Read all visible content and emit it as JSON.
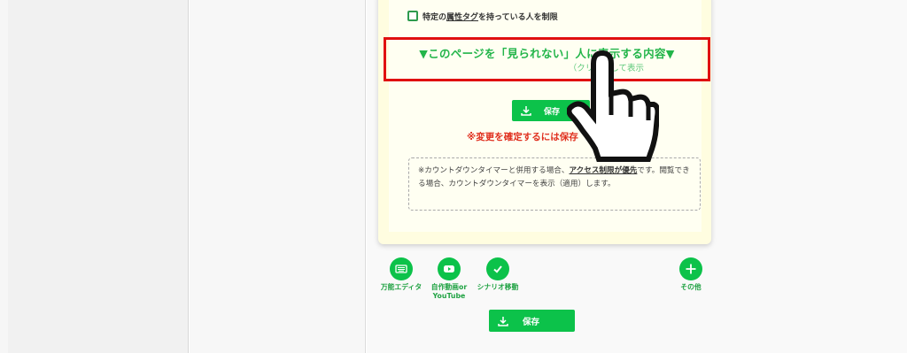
{
  "restriction": {
    "prefix": "特定の",
    "link": "属性タグ",
    "suffix": "を持っている人を制限"
  },
  "hidden_content": {
    "title": "▼このページを「見られない」人に表示する内容▼",
    "subtitle": "（クリックして表示"
  },
  "card_save_button": {
    "label": "保存"
  },
  "confirm_message": "※変更を確定するには保存",
  "note": {
    "part1": "※カウントダウンタイマーと併用する場合、",
    "link": "アクセス制限が優先",
    "part2": "です。閲覧できる場合、カウントダウンタイマーを表示（適用）します。"
  },
  "toolbar": {
    "items": [
      {
        "label": "万能エディタ",
        "icon": "keyboard-icon"
      },
      {
        "label": "自作動画or\nYouTube",
        "icon": "youtube-icon"
      },
      {
        "label": "シナリオ移動",
        "icon": "check-icon"
      },
      {
        "label": "その他",
        "icon": "plus-icon"
      }
    ]
  },
  "save_button": {
    "label": "保存"
  },
  "colors": {
    "accent": "#0cc24a",
    "highlight": "#e01010",
    "warning": "#e0301f"
  }
}
